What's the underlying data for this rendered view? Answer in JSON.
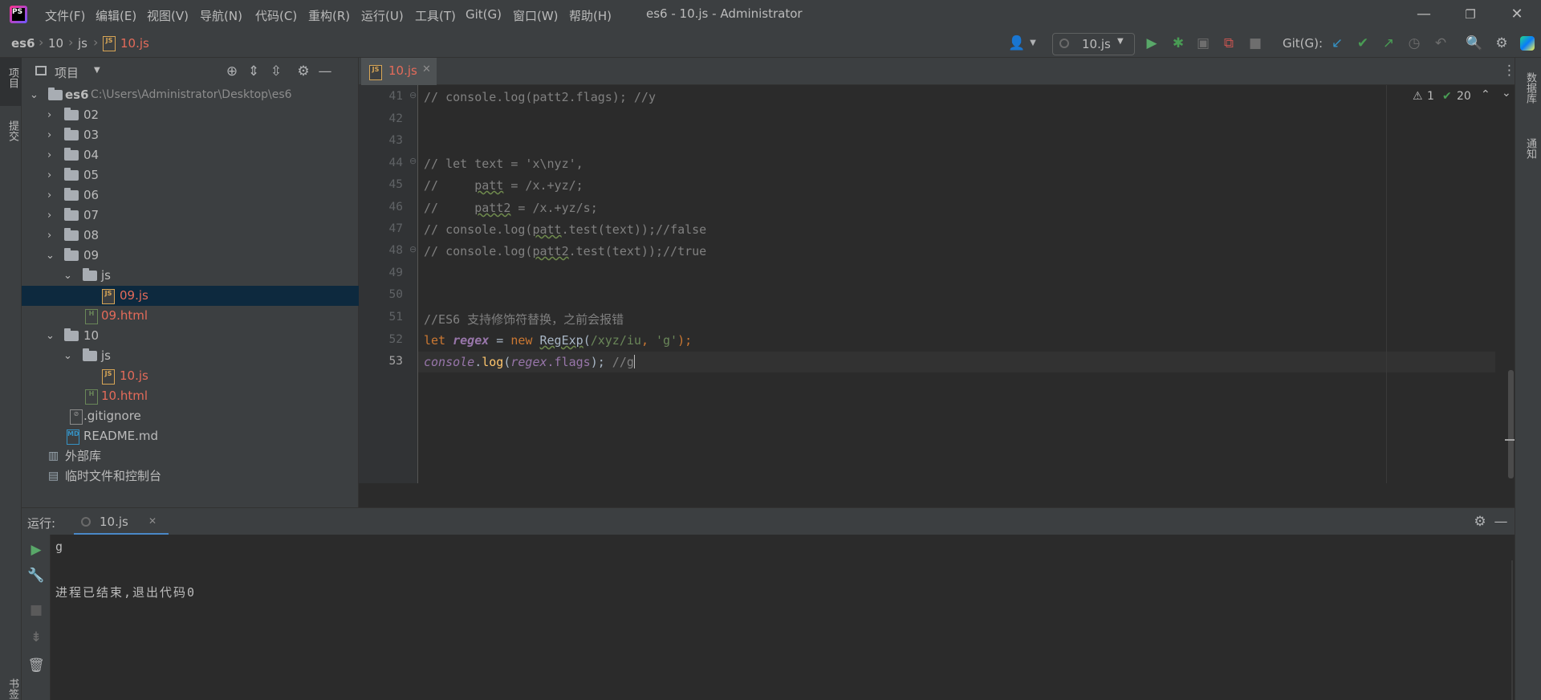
{
  "titlebar": {
    "menus": [
      "文件(F)",
      "编辑(E)",
      "视图(V)",
      "导航(N)",
      "代码(C)",
      "重构(R)",
      "运行(U)",
      "工具(T)",
      "Git(G)",
      "窗口(W)",
      "帮助(H)"
    ],
    "title": "es6 - 10.js - Administrator"
  },
  "breadcrumb": [
    "es6",
    "10",
    "js",
    "10.js"
  ],
  "toolbar": {
    "run_config": "10.js",
    "git_label": "Git(G):"
  },
  "left_strip": {
    "project": "项目",
    "commit": "提交",
    "structure": "书签"
  },
  "right_strip": {
    "database": "数据库",
    "notifications": "通知"
  },
  "project": {
    "title": "项目",
    "root_name": "es6",
    "root_path": "C:\\Users\\Administrator\\Desktop\\es6",
    "items": [
      {
        "label": "02"
      },
      {
        "label": "03"
      },
      {
        "label": "04"
      },
      {
        "label": "05"
      },
      {
        "label": "06"
      },
      {
        "label": "07"
      },
      {
        "label": "08"
      },
      {
        "label": "09"
      },
      {
        "label": "js"
      },
      {
        "label": "09.js"
      },
      {
        "label": "09.html"
      },
      {
        "label": "10"
      },
      {
        "label": "js"
      },
      {
        "label": "10.js"
      },
      {
        "label": "10.html"
      },
      {
        "label": ".gitignore"
      },
      {
        "label": "README.md"
      },
      {
        "label": "外部库"
      },
      {
        "label": "临时文件和控制台"
      }
    ]
  },
  "editor": {
    "tab": "10.js",
    "warnings": "1",
    "checks": "20",
    "line_numbers": [
      "41",
      "42",
      "43",
      "44",
      "45",
      "46",
      "47",
      "48",
      "49",
      "50",
      "51",
      "52",
      "53"
    ],
    "lines": {
      "l41": "// console.log(patt2.flags); //y",
      "l44": "// let text = 'x\\nyz',",
      "l45a": "//     ",
      "l45b": "patt",
      "l45c": " = /x.+yz/;",
      "l46a": "//     ",
      "l46b": "patt2",
      "l46c": " = /x.+yz/s;",
      "l47a": "// console.log(",
      "l47b": "patt",
      "l47c": ".test(text));//false",
      "l48a": "// console.log(",
      "l48b": "patt2",
      "l48c": ".test(text));//true",
      "l51": "//ES6 支持修饰符替换，之前会报错",
      "l52_let": "let",
      "l52_var": "regex",
      "l52_eq": " = ",
      "l52_new": "new",
      "l52_cls": "RegExp",
      "l52_open": "(",
      "l52_rx": "/xyz/iu",
      "l52_comma": ", ",
      "l52_str": "'g'",
      "l52_close": ");",
      "l53_console": "console",
      "l53_dot": ".",
      "l53_log": "log",
      "l53_open": "(",
      "l53_var": "regex",
      "l53_flags": ".flags",
      "l53_close": ");",
      "l53_cmt": " //g"
    }
  },
  "run": {
    "label": "运行:",
    "tab": "10.js",
    "output": [
      "g",
      "",
      "进程已结束,退出代码0"
    ]
  },
  "colors": {
    "accent": "#4a88c7",
    "selection": "#0d293e",
    "error_file": "#e46b5a"
  }
}
